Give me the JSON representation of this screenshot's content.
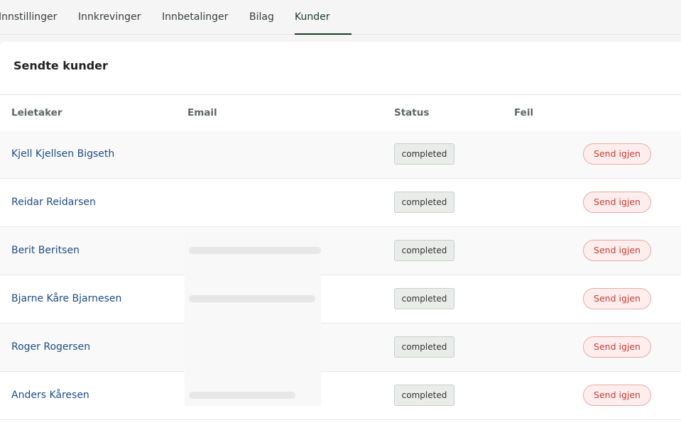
{
  "tabs": [
    {
      "label": "Innstillinger",
      "active": false
    },
    {
      "label": "Innkrevinger",
      "active": false
    },
    {
      "label": "Innbetalinger",
      "active": false
    },
    {
      "label": "Bilag",
      "active": false
    },
    {
      "label": "Kunder",
      "active": true
    }
  ],
  "card": {
    "title": "Sendte kunder"
  },
  "table": {
    "columns": [
      "Leietaker",
      "Email",
      "Status",
      "Feil"
    ],
    "rows": [
      {
        "tenant": "Kjell Kjellsen Bigseth",
        "email": "",
        "status": "completed",
        "error": "",
        "action": "Send igjen"
      },
      {
        "tenant": "Reidar Reidarsen",
        "email": "",
        "status": "completed",
        "error": "",
        "action": "Send igjen"
      },
      {
        "tenant": "Berit Beritsen",
        "email": "",
        "status": "completed",
        "error": "",
        "action": "Send igjen"
      },
      {
        "tenant": "Bjarne Kåre Bjarnesen",
        "email": "",
        "status": "completed",
        "error": "",
        "action": "Send igjen"
      },
      {
        "tenant": "Roger Rogersen",
        "email": "",
        "status": "completed",
        "error": "",
        "action": "Send igjen"
      },
      {
        "tenant": "Anders Kåresen",
        "email": "",
        "status": "completed",
        "error": "",
        "action": "Send igjen"
      }
    ]
  },
  "colors": {
    "accent": "#1f3b2c",
    "link": "#1e4c86",
    "danger": "#c83d36"
  }
}
